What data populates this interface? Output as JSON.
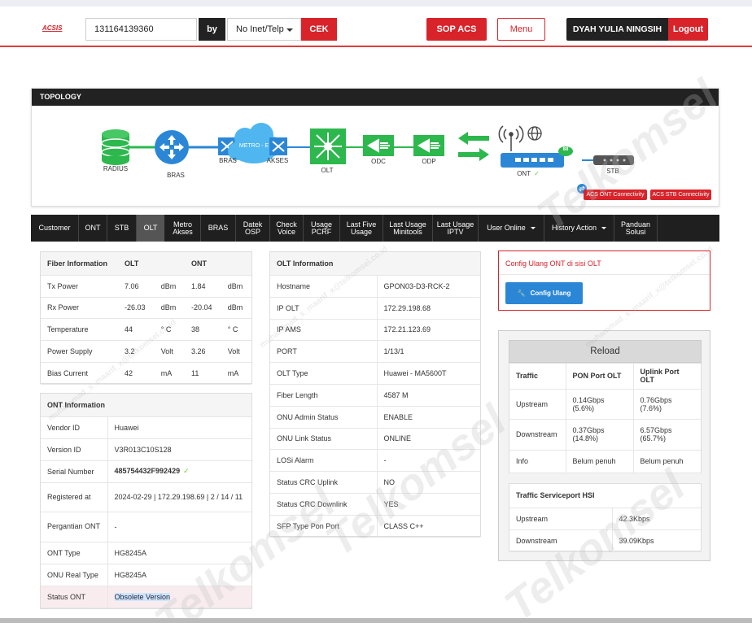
{
  "header": {
    "logo": "ACSIS",
    "search_value": "131164139360",
    "by_label": "by",
    "search_type": "No Inet/Telp",
    "cek_label": "CEK",
    "sop_label": "SOP ACS",
    "menu_label": "Menu",
    "user_name": "DYAH YULIA NINGSIH",
    "logout_label": "Logout"
  },
  "topology": {
    "title": "TOPOLOGY",
    "nodes": {
      "radius": "RADIUS",
      "bras": "BRAS",
      "bras2": "BRAS",
      "metro": "METRO - E",
      "akses": "AKSES",
      "olt": "OLT",
      "odc": "ODC",
      "odp": "ODP",
      "ont": "ONT",
      "stb": "STB"
    },
    "ont_signal": "88",
    "acs_ont": "ACS ONT Connectivity",
    "acs_stb": "ACS STB Connectivity"
  },
  "tabs": [
    {
      "label": "Customer"
    },
    {
      "label": "ONT"
    },
    {
      "label": "STB"
    },
    {
      "label": "OLT"
    },
    {
      "label": "Metro Akses"
    },
    {
      "label": "BRAS"
    },
    {
      "label": "Datek OSP"
    },
    {
      "label": "Check Voice"
    },
    {
      "label": "Usage PCRF"
    },
    {
      "label": "Last Five Usage"
    },
    {
      "label": "Last Usage Minitools"
    },
    {
      "label": "Last Usage IPTV"
    },
    {
      "label": "User Online"
    },
    {
      "label": "History Action"
    },
    {
      "label": "Panduan Solusi"
    }
  ],
  "fiber": {
    "headers": [
      "Fiber Information",
      "OLT",
      "ONT"
    ],
    "rows": [
      [
        "Tx Power",
        "7.06",
        "dBm",
        "1.84",
        "dBm"
      ],
      [
        "Rx Power",
        "-26.03",
        "dBm",
        "-20.04",
        "dBm"
      ],
      [
        "Temperature",
        "44",
        "° C",
        "38",
        "° C"
      ],
      [
        "Power Supply",
        "3.2",
        "Volt",
        "3.26",
        "Volt"
      ],
      [
        "Bias Current",
        "42",
        "mA",
        "11",
        "mA"
      ]
    ]
  },
  "ont_info": {
    "title": "ONT Information",
    "rows": [
      [
        "Vendor ID",
        "Huawei"
      ],
      [
        "Version ID",
        "V3R013C10S128"
      ],
      [
        "Serial Number",
        "485754432F992429"
      ],
      [
        "Registered at",
        "2024-02-29 | 172.29.198.69 | 2 / 14 / 11"
      ],
      [
        "Pergantian ONT",
        "-"
      ],
      [
        "ONT Type",
        "HG8245A"
      ],
      [
        "ONU Real Type",
        "HG8245A"
      ],
      [
        "Status ONT",
        "Obsolete Version"
      ]
    ]
  },
  "olt_info": {
    "title": "OLT Information",
    "rows": [
      [
        "Hostname",
        "GPON03-D3-RCK-2"
      ],
      [
        "IP OLT",
        "172.29.198.68"
      ],
      [
        "IP AMS",
        "172.21.123.69"
      ],
      [
        "PORT",
        "1/13/1"
      ],
      [
        "OLT Type",
        "Huawei - MA5600T"
      ],
      [
        "Fiber Length",
        "4587 M"
      ],
      [
        "ONU Admin Status",
        "ENABLE"
      ],
      [
        "ONU Link Status",
        "ONLINE"
      ],
      [
        "LOSi Alarm",
        "-"
      ],
      [
        "Status CRC Uplink",
        "NO"
      ],
      [
        "Status CRC Downlink",
        "YES"
      ],
      [
        "SFP Type Pon Port",
        "CLASS C++"
      ]
    ]
  },
  "config": {
    "title": "Config Ulang ONT di sisi OLT",
    "button": "Config Ulang"
  },
  "traffic": {
    "reload": "Reload",
    "headers": [
      "Traffic",
      "PON Port OLT",
      "Uplink Port OLT"
    ],
    "rows": [
      [
        "Upstream",
        "0.14Gbps",
        "(5.6%)",
        "0.76Gbps",
        "(7.6%)"
      ],
      [
        "Downstream",
        "0.37Gbps",
        "(14.8%)",
        "6.57Gbps",
        "(65.7%)"
      ],
      [
        "Info",
        "Belum penuh",
        "",
        "Belum penuh",
        ""
      ]
    ],
    "hsi_title": "Traffic Serviceport HSI",
    "hsi_rows": [
      [
        "Upstream",
        "42.3Kbps"
      ],
      [
        "Downstream",
        "39.09Kbps"
      ]
    ]
  },
  "watermark": {
    "brand": "Telkomsel",
    "user": "muhammad_s_maarif_x@telkomsel.co.id"
  },
  "colors": {
    "accent": "#d8232a",
    "topology_green": "#2db84d",
    "topology_blue": "#2b87d6"
  }
}
